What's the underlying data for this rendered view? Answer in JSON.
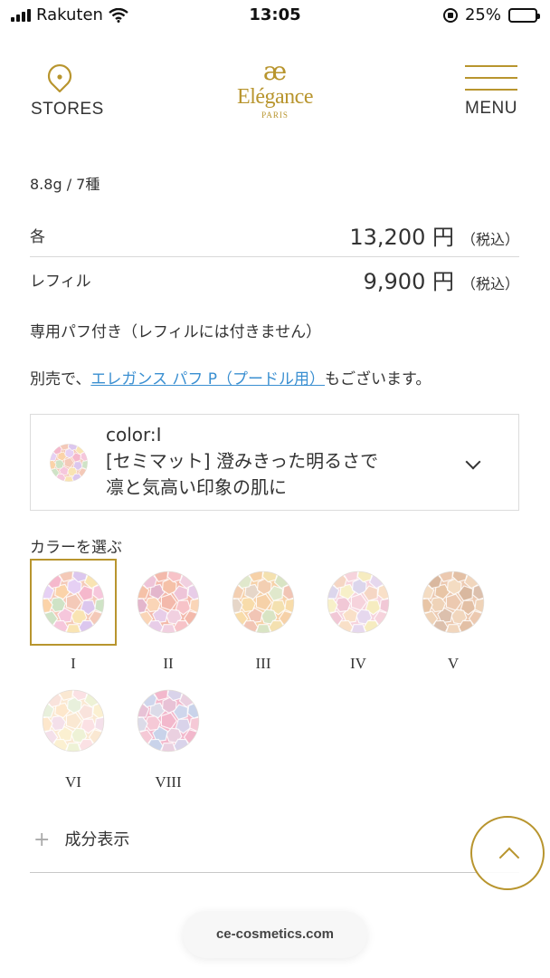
{
  "status_bar": {
    "carrier": "Rakuten",
    "time": "13:05",
    "battery": "25%",
    "battery_level": 0.25
  },
  "header": {
    "stores_label": "STORES",
    "logo_mark": "æ",
    "logo_name": "Elégance",
    "logo_sub": "PARIS",
    "menu_label": "MENU",
    "accent_color": "#b8952e"
  },
  "product": {
    "weight": "8.8g / 7種",
    "prices": [
      {
        "name": "各",
        "amount": "13,200 円",
        "tax": "（税込）"
      },
      {
        "name": "レフィル",
        "amount": "9,900 円",
        "tax": "（税込）"
      }
    ],
    "note_puff": "専用パフ付き（レフィルには付きません）",
    "note_sold_prefix": "別売で、",
    "note_sold_link": "エレガンス パフ P（プードル用）",
    "note_sold_suffix": "もございます。"
  },
  "selector": {
    "color_line": "color:I",
    "desc_line1": "[セミマット] 澄みきった明るさで",
    "desc_line2": "凛と気高い印象の肌に"
  },
  "colors": {
    "label": "カラーを選ぶ",
    "selected": "I",
    "swatches": [
      {
        "label": "I",
        "palette": [
          "#f4c9b8",
          "#dcc7ee",
          "#f9e4b3",
          "#f6c7dc",
          "#cfe3c6",
          "#fbd3a9",
          "#e6d0f4",
          "#f5b8cc"
        ]
      },
      {
        "label": "II",
        "palette": [
          "#f3b9ab",
          "#f7c3c8",
          "#f1d0e0",
          "#e8cde8",
          "#fad5b7",
          "#e3b6cc",
          "#f5c1a8",
          "#eec4d8"
        ]
      },
      {
        "label": "III",
        "palette": [
          "#f6d1a8",
          "#f4e1b0",
          "#d9e4c4",
          "#f1c5b5",
          "#f8dcaa",
          "#e6d6c8",
          "#f3cfb2",
          "#e0e8cc"
        ]
      },
      {
        "label": "IV",
        "palette": [
          "#f6d3dc",
          "#f6ecc0",
          "#e6d8ee",
          "#f9e0c8",
          "#f1c8d6",
          "#f7f0c9",
          "#dcd6ec",
          "#f5d6c4"
        ]
      },
      {
        "label": "V",
        "palette": [
          "#ecc9b0",
          "#e3c0a5",
          "#f1d6bd",
          "#dcc0ad",
          "#efd3b8",
          "#e8c5a6",
          "#f4dcc2",
          "#d9b89f"
        ]
      },
      {
        "label": "VI",
        "palette": [
          "#fae8d2",
          "#fbe1e4",
          "#eef2d6",
          "#fbf0d1",
          "#f4e0ea",
          "#fde7cc",
          "#e8f0dc",
          "#f9e3dc"
        ]
      },
      {
        "label": "VIII",
        "palette": [
          "#f2b8cc",
          "#d9d3ea",
          "#ead0e0",
          "#c9d3ea",
          "#f5c9d6",
          "#dcdbe8",
          "#e8c2d6",
          "#cfd6ec"
        ]
      }
    ]
  },
  "ingredients": {
    "icon": "plus-icon",
    "label": "成分表示"
  },
  "url_bar": {
    "text": "ce-cosmetics.com"
  }
}
